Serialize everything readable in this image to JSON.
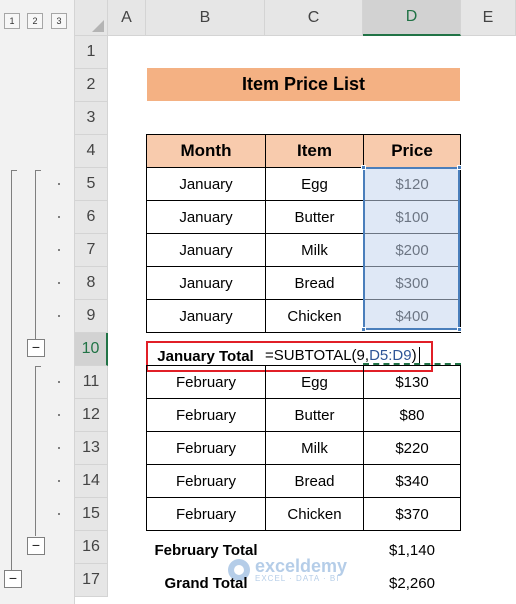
{
  "outline": {
    "levels": [
      "1",
      "2",
      "3"
    ],
    "collapse_symbol": "−"
  },
  "columns": [
    "A",
    "B",
    "C",
    "D",
    "E"
  ],
  "rows": [
    "1",
    "2",
    "3",
    "4",
    "5",
    "6",
    "7",
    "8",
    "9",
    "10",
    "11",
    "12",
    "13",
    "14",
    "15",
    "16",
    "17"
  ],
  "sheet": {
    "title": "Item Price List",
    "headers": {
      "month": "Month",
      "item": "Item",
      "price": "Price"
    },
    "january": [
      {
        "month": "January",
        "item": "Egg",
        "price": "$120"
      },
      {
        "month": "January",
        "item": "Butter",
        "price": "$100"
      },
      {
        "month": "January",
        "item": "Milk",
        "price": "$200"
      },
      {
        "month": "January",
        "item": "Bread",
        "price": "$300"
      },
      {
        "month": "January",
        "item": "Chicken",
        "price": "$400"
      }
    ],
    "january_total_label": "January Total",
    "formula_fn": "=SUBTOTAL(9,",
    "formula_ref": "D5:D9",
    "formula_close": ")",
    "february": [
      {
        "month": "February",
        "item": "Egg",
        "price": "$130"
      },
      {
        "month": "February",
        "item": "Butter",
        "price": "$80"
      },
      {
        "month": "February",
        "item": "Milk",
        "price": "$220"
      },
      {
        "month": "February",
        "item": "Bread",
        "price": "$340"
      },
      {
        "month": "February",
        "item": "Chicken",
        "price": "$370"
      }
    ],
    "february_total_label": "February Total",
    "february_total_value": "$1,140",
    "grand_total_label": "Grand Total",
    "grand_total_value": "$2,260"
  },
  "watermark": {
    "name": "exceldemy",
    "tagline": "EXCEL · DATA · BI"
  },
  "colors": {
    "title_fill": "#f4b183",
    "header_fill": "#f8cbad",
    "selection_fill": "#c5d6ef",
    "selection_border": "#4a7ebb",
    "highlight_border": "#e11f27",
    "excel_green": "#217346"
  }
}
